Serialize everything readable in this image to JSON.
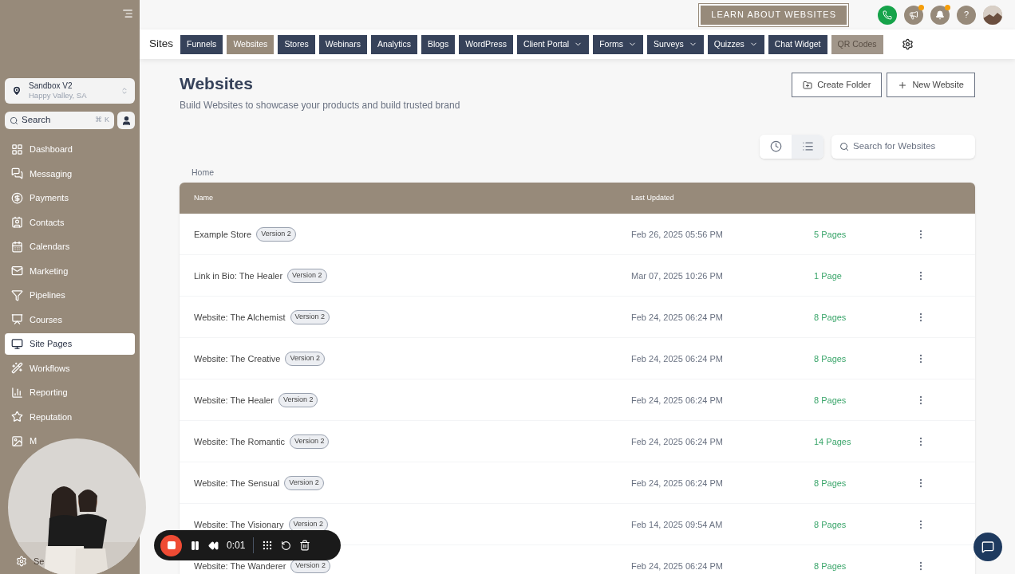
{
  "sidebar": {
    "location": {
      "name": "Sandbox V2",
      "address": "Happy Valley, SA"
    },
    "search": {
      "placeholder": "Search",
      "shortcut": "⌘ K"
    },
    "items": [
      {
        "label": "Dashboard",
        "selected": false
      },
      {
        "label": "Messaging",
        "selected": false
      },
      {
        "label": "Payments",
        "selected": false
      },
      {
        "label": "Contacts",
        "selected": false
      },
      {
        "label": "Calendars",
        "selected": false
      },
      {
        "label": "Marketing",
        "selected": false
      },
      {
        "label": "Pipelines",
        "selected": false
      },
      {
        "label": "Courses",
        "selected": false
      },
      {
        "label": "Site Pages",
        "selected": true
      },
      {
        "label": "Workflows",
        "selected": false
      },
      {
        "label": "Reporting",
        "selected": false
      },
      {
        "label": "Reputation",
        "selected": false
      },
      {
        "label": "M",
        "selected": false
      }
    ],
    "settings": {
      "label": "Se"
    }
  },
  "topbar": {
    "learn_button": "LEARN ABOUT WEBSITES",
    "icons": [
      {
        "kind": "phone",
        "notification": false
      },
      {
        "kind": "megaphone",
        "notification": true
      },
      {
        "kind": "bell",
        "notification": true
      },
      {
        "kind": "help",
        "notification": false,
        "text": "?"
      },
      {
        "kind": "avatar"
      }
    ]
  },
  "nav": {
    "title": "Sites",
    "tabs": [
      {
        "label": "Funnels",
        "selected": false,
        "hovered": false,
        "dropdown": false
      },
      {
        "label": "Websites",
        "selected": true,
        "hovered": false,
        "dropdown": false
      },
      {
        "label": "Stores",
        "selected": false,
        "hovered": false,
        "dropdown": false
      },
      {
        "label": "Webinars",
        "selected": false,
        "hovered": false,
        "dropdown": false
      },
      {
        "label": "Analytics",
        "selected": false,
        "hovered": false,
        "dropdown": false
      },
      {
        "label": "Blogs",
        "selected": false,
        "hovered": false,
        "dropdown": false
      },
      {
        "label": "WordPress",
        "selected": false,
        "hovered": false,
        "dropdown": false
      },
      {
        "label": "Client Portal",
        "selected": false,
        "hovered": false,
        "dropdown": true
      },
      {
        "label": "Forms",
        "selected": false,
        "hovered": false,
        "dropdown": true
      },
      {
        "label": "Surveys",
        "selected": false,
        "hovered": false,
        "dropdown": true
      },
      {
        "label": "Quizzes",
        "selected": false,
        "hovered": false,
        "dropdown": true
      },
      {
        "label": "Chat Widget",
        "selected": false,
        "hovered": false,
        "dropdown": false
      },
      {
        "label": "QR Codes",
        "selected": false,
        "hovered": true,
        "dropdown": false
      }
    ]
  },
  "page": {
    "title": "Websites",
    "subtitle": "Build Websites to showcase your products and build trusted brand",
    "buttons": [
      "Create Folder",
      "New Website"
    ],
    "views": [
      {
        "kind": "recent",
        "selected": false
      },
      {
        "kind": "list",
        "selected": true
      }
    ],
    "search": {
      "placeholder": "Search for Websites"
    },
    "breadcrumb": "Home"
  },
  "table": {
    "columns": [
      "Name",
      "Last Updated"
    ],
    "rows": [
      {
        "name": "Example Store",
        "version": "Version 2",
        "updated": "Feb 26, 2025 05:56 PM",
        "pages": "5 Pages"
      },
      {
        "name": "Link in Bio: The Healer",
        "version": "Version 2",
        "updated": "Mar 07, 2025 10:26 PM",
        "pages": "1 Page"
      },
      {
        "name": "Website: The Alchemist",
        "version": "Version 2",
        "updated": "Feb 24, 2025 06:24 PM",
        "pages": "8 Pages"
      },
      {
        "name": "Website: The Creative",
        "version": "Version 2",
        "updated": "Feb 24, 2025 06:24 PM",
        "pages": "8 Pages"
      },
      {
        "name": "Website: The Healer",
        "version": "Version 2",
        "updated": "Feb 24, 2025 06:24 PM",
        "pages": "8 Pages"
      },
      {
        "name": "Website: The Romantic",
        "version": "Version 2",
        "updated": "Feb 24, 2025 06:24 PM",
        "pages": "14 Pages"
      },
      {
        "name": "Website: The Sensual",
        "version": "Version 2",
        "updated": "Feb 24, 2025 06:24 PM",
        "pages": "8 Pages"
      },
      {
        "name": "Website: The Visionary",
        "version": "Version 2",
        "updated": "Feb 14, 2025 09:54 AM",
        "pages": "8 Pages"
      },
      {
        "name": "Website: The Wanderer",
        "version": "Version 2",
        "updated": "Feb 24, 2025 06:24 PM",
        "pages": "8 Pages"
      }
    ]
  },
  "recorder": {
    "time": "0:01"
  }
}
